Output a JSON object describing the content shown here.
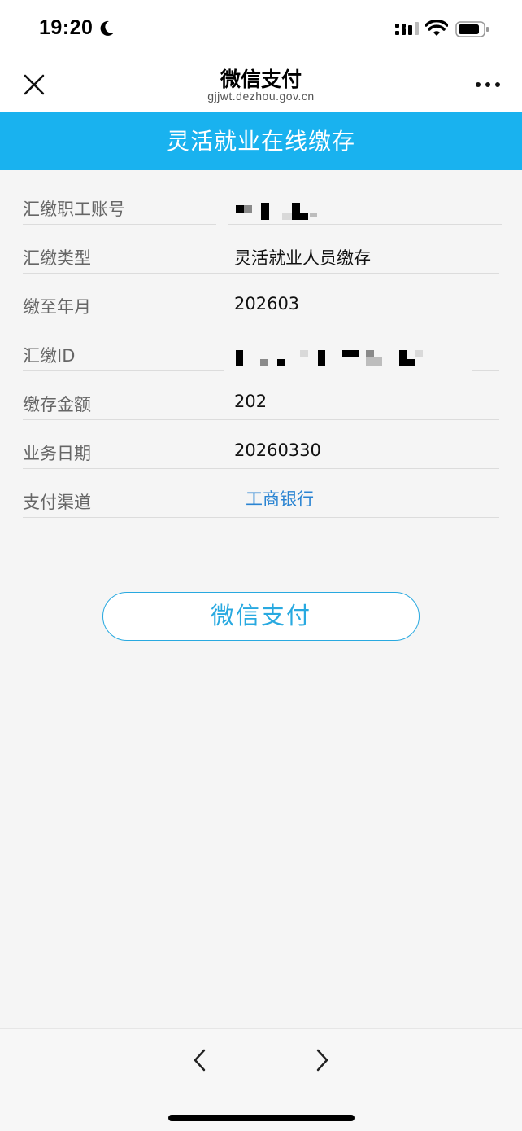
{
  "status_bar": {
    "time": "19:20",
    "icons": [
      "moon-icon",
      "cellular-signal-icon",
      "wifi-icon",
      "battery-icon"
    ]
  },
  "nav": {
    "title": "微信支付",
    "subtitle": "gjjwt.dezhou.gov.cn",
    "icons": [
      "close-icon",
      "more-icon"
    ]
  },
  "banner": {
    "title": "灵活就业在线缴存"
  },
  "form": {
    "rows": [
      {
        "label": "汇缴职工账号",
        "value": ""
      },
      {
        "label": "汇缴类型",
        "value": "灵活就业人员缴存"
      },
      {
        "label": "缴至年月",
        "value": "202603"
      },
      {
        "label": "汇缴ID",
        "value": ""
      },
      {
        "label": "缴存金额",
        "value": "202"
      },
      {
        "label": "业务日期",
        "value": "20260330"
      },
      {
        "label": "支付渠道",
        "value": "工商银行"
      }
    ]
  },
  "pay_button": {
    "label": "微信支付"
  },
  "bottom": {
    "icons": [
      "chevron-left-icon",
      "chevron-right-icon"
    ]
  },
  "colors": {
    "accent": "#19b2ef",
    "link": "#2a84d2",
    "button": "#28a9e0",
    "background": "#f5f5f5"
  }
}
